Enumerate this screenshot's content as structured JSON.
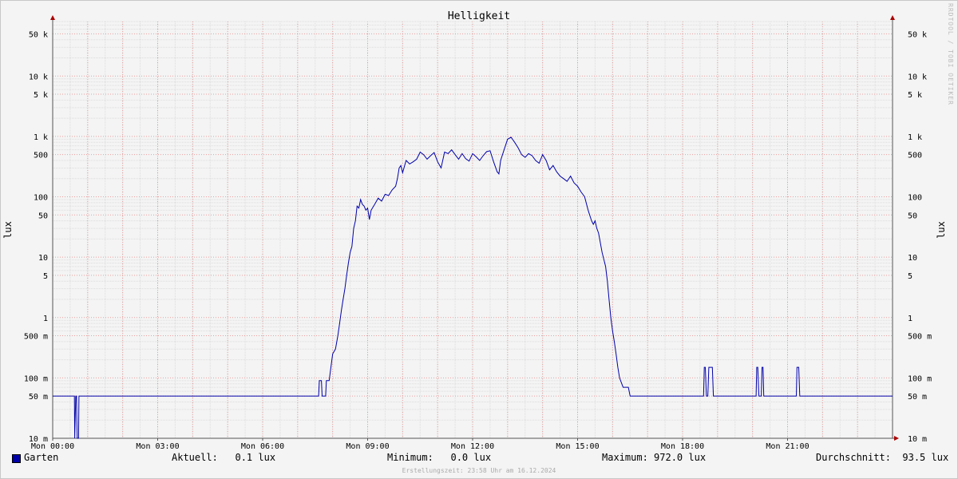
{
  "chart_data": {
    "type": "line",
    "title": "Helligkeit",
    "ylabel": "lux",
    "yscale": "log",
    "ylim": [
      0.01,
      80000
    ],
    "grid": true,
    "x_unit": "hours",
    "x_range": [
      0,
      24
    ],
    "x_ticks": [
      {
        "value": 0,
        "label": "Mon 00:00"
      },
      {
        "value": 3,
        "label": "Mon 03:00"
      },
      {
        "value": 6,
        "label": "Mon 06:00"
      },
      {
        "value": 9,
        "label": "Mon 09:00"
      },
      {
        "value": 12,
        "label": "Mon 12:00"
      },
      {
        "value": 15,
        "label": "Mon 15:00"
      },
      {
        "value": 18,
        "label": "Mon 18:00"
      },
      {
        "value": 21,
        "label": "Mon 21:00"
      }
    ],
    "y_ticks": [
      {
        "value": 0.01,
        "label": "10 m"
      },
      {
        "value": 0.05,
        "label": "50 m"
      },
      {
        "value": 0.1,
        "label": "100 m"
      },
      {
        "value": 0.5,
        "label": "500 m"
      },
      {
        "value": 1,
        "label": "1"
      },
      {
        "value": 5,
        "label": "5"
      },
      {
        "value": 10,
        "label": "10"
      },
      {
        "value": 50,
        "label": "50"
      },
      {
        "value": 100,
        "label": "100"
      },
      {
        "value": 500,
        "label": "500"
      },
      {
        "value": 1000,
        "label": "1 k"
      },
      {
        "value": 5000,
        "label": "5 k"
      },
      {
        "value": 10000,
        "label": "10 k"
      },
      {
        "value": 50000,
        "label": "50 k"
      }
    ],
    "series": [
      {
        "name": "Garten",
        "color": "#0000aa",
        "points": [
          [
            0.0,
            0.05
          ],
          [
            0.62,
            0.05
          ],
          [
            0.63,
            0.01
          ],
          [
            0.66,
            0.05
          ],
          [
            0.68,
            0.05
          ],
          [
            0.7,
            0.01
          ],
          [
            0.74,
            0.01
          ],
          [
            0.75,
            0.05
          ],
          [
            7.6,
            0.05
          ],
          [
            7.62,
            0.09
          ],
          [
            7.68,
            0.09
          ],
          [
            7.7,
            0.05
          ],
          [
            7.8,
            0.05
          ],
          [
            7.82,
            0.09
          ],
          [
            7.9,
            0.09
          ],
          [
            7.95,
            0.15
          ],
          [
            8.0,
            0.25
          ],
          [
            8.08,
            0.3
          ],
          [
            8.15,
            0.5
          ],
          [
            8.2,
            0.8
          ],
          [
            8.25,
            1.3
          ],
          [
            8.3,
            2
          ],
          [
            8.35,
            3
          ],
          [
            8.4,
            5
          ],
          [
            8.45,
            8
          ],
          [
            8.5,
            12
          ],
          [
            8.55,
            15
          ],
          [
            8.6,
            30
          ],
          [
            8.65,
            40
          ],
          [
            8.7,
            70
          ],
          [
            8.75,
            65
          ],
          [
            8.8,
            90
          ],
          [
            8.85,
            75
          ],
          [
            8.9,
            70
          ],
          [
            8.95,
            60
          ],
          [
            9.0,
            65
          ],
          [
            9.05,
            42
          ],
          [
            9.1,
            60
          ],
          [
            9.2,
            75
          ],
          [
            9.3,
            95
          ],
          [
            9.4,
            85
          ],
          [
            9.5,
            110
          ],
          [
            9.6,
            105
          ],
          [
            9.7,
            130
          ],
          [
            9.8,
            150
          ],
          [
            9.85,
            200
          ],
          [
            9.9,
            300
          ],
          [
            9.95,
            330
          ],
          [
            10.0,
            250
          ],
          [
            10.1,
            400
          ],
          [
            10.2,
            350
          ],
          [
            10.3,
            380
          ],
          [
            10.4,
            420
          ],
          [
            10.5,
            550
          ],
          [
            10.6,
            500
          ],
          [
            10.7,
            420
          ],
          [
            10.8,
            480
          ],
          [
            10.9,
            540
          ],
          [
            11.0,
            380
          ],
          [
            11.1,
            300
          ],
          [
            11.2,
            550
          ],
          [
            11.3,
            520
          ],
          [
            11.4,
            600
          ],
          [
            11.5,
            500
          ],
          [
            11.6,
            420
          ],
          [
            11.7,
            520
          ],
          [
            11.8,
            430
          ],
          [
            11.9,
            390
          ],
          [
            12.0,
            520
          ],
          [
            12.1,
            460
          ],
          [
            12.2,
            400
          ],
          [
            12.3,
            480
          ],
          [
            12.4,
            560
          ],
          [
            12.5,
            580
          ],
          [
            12.6,
            380
          ],
          [
            12.7,
            260
          ],
          [
            12.75,
            240
          ],
          [
            12.8,
            400
          ],
          [
            12.9,
            600
          ],
          [
            13.0,
            900
          ],
          [
            13.1,
            970
          ],
          [
            13.2,
            800
          ],
          [
            13.3,
            650
          ],
          [
            13.4,
            500
          ],
          [
            13.5,
            450
          ],
          [
            13.6,
            520
          ],
          [
            13.7,
            480
          ],
          [
            13.8,
            400
          ],
          [
            13.9,
            360
          ],
          [
            14.0,
            500
          ],
          [
            14.1,
            400
          ],
          [
            14.2,
            280
          ],
          [
            14.3,
            330
          ],
          [
            14.4,
            260
          ],
          [
            14.5,
            220
          ],
          [
            14.6,
            200
          ],
          [
            14.7,
            180
          ],
          [
            14.8,
            220
          ],
          [
            14.9,
            170
          ],
          [
            15.0,
            150
          ],
          [
            15.1,
            120
          ],
          [
            15.2,
            100
          ],
          [
            15.3,
            60
          ],
          [
            15.4,
            40
          ],
          [
            15.45,
            35
          ],
          [
            15.5,
            40
          ],
          [
            15.55,
            30
          ],
          [
            15.6,
            25
          ],
          [
            15.7,
            12
          ],
          [
            15.8,
            7
          ],
          [
            15.85,
            4
          ],
          [
            15.9,
            2
          ],
          [
            15.95,
            1
          ],
          [
            16.0,
            0.6
          ],
          [
            16.05,
            0.4
          ],
          [
            16.1,
            0.25
          ],
          [
            16.15,
            0.15
          ],
          [
            16.2,
            0.1
          ],
          [
            16.3,
            0.07
          ],
          [
            16.45,
            0.07
          ],
          [
            16.5,
            0.05
          ],
          [
            18.6,
            0.05
          ],
          [
            18.62,
            0.15
          ],
          [
            18.65,
            0.15
          ],
          [
            18.68,
            0.05
          ],
          [
            18.72,
            0.05
          ],
          [
            18.75,
            0.15
          ],
          [
            18.85,
            0.15
          ],
          [
            18.88,
            0.05
          ],
          [
            20.1,
            0.05
          ],
          [
            20.12,
            0.15
          ],
          [
            20.15,
            0.15
          ],
          [
            20.18,
            0.05
          ],
          [
            20.25,
            0.05
          ],
          [
            20.27,
            0.15
          ],
          [
            20.3,
            0.15
          ],
          [
            20.32,
            0.05
          ],
          [
            21.25,
            0.05
          ],
          [
            21.27,
            0.15
          ],
          [
            21.32,
            0.15
          ],
          [
            21.35,
            0.05
          ],
          [
            24.0,
            0.05
          ]
        ]
      }
    ]
  },
  "legend": {
    "series_label": "Garten",
    "current": "Aktuell:   0.1 lux",
    "minimum": "Minimum:   0.0 lux",
    "maximum": "Maximum: 972.0 lux",
    "average": "Durchschnitt:  93.5 lux"
  },
  "footer": "Erstellungszeit: 23:58 Uhr am 16.12.2024",
  "watermark": "RRDTOOL / TOBI OETIKER",
  "colors": {
    "line": "#0000aa",
    "minor_grid": "#dcdcdc",
    "major_grid": "#e8a0a0",
    "axis": "#555555"
  }
}
